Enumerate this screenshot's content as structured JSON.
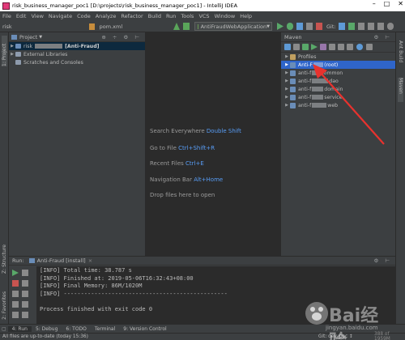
{
  "window": {
    "title": "risk_business_manager_poc1 [D:\\projects\\risk_business_manager_poc1] - IntelliJ IDEA",
    "controls": [
      "–",
      "□",
      "✕"
    ]
  },
  "menu": [
    "File",
    "Edit",
    "View",
    "Navigate",
    "Code",
    "Analyze",
    "Refactor",
    "Build",
    "Run",
    "Tools",
    "VCS",
    "Window",
    "Help"
  ],
  "toolbar": {
    "breadcrumb": "risk",
    "open_file": "pom.xml",
    "run_config": "AntiFraudWebApplication",
    "git_label": "Git:"
  },
  "project_panel": {
    "title": "Project",
    "rows": [
      {
        "label": "risk",
        "suffix": "[Anti-Fraud]",
        "selected": true
      },
      {
        "label": "External Libraries",
        "selected": false
      },
      {
        "label": "Scratches and Consoles",
        "selected": false
      }
    ]
  },
  "editor_hints": [
    {
      "text": "Search Everywhere",
      "key": "Double Shift"
    },
    {
      "text": "Go to File",
      "key": "Ctrl+Shift+R"
    },
    {
      "text": "Recent Files",
      "key": "Ctrl+E"
    },
    {
      "text": "Navigation Bar",
      "key": "Alt+Home"
    },
    {
      "text": "Drop files here to open",
      "key": ""
    }
  ],
  "maven_panel": {
    "title": "Maven",
    "rows": [
      {
        "label": "Profiles",
        "tail": "",
        "selected": false
      },
      {
        "label": "Anti-F",
        "tail": "(root)",
        "selected": true
      },
      {
        "label": "anti-f",
        "tail": "common",
        "selected": false
      },
      {
        "label": "anti-f",
        "tail": "dao",
        "selected": false
      },
      {
        "label": "anti-f",
        "tail": "domain",
        "selected": false
      },
      {
        "label": "anti-f",
        "tail": "service",
        "selected": false
      },
      {
        "label": "anti-f",
        "tail": "web",
        "selected": false
      }
    ]
  },
  "left_stripe": {
    "project_tab": "1: Project",
    "structure_tab": "Z: Structure",
    "favorites_tab": "2: Favorites"
  },
  "right_stripe": {
    "ant_tab": "Ant Build",
    "maven_tab": "Maven"
  },
  "run_panel": {
    "label": "Run:",
    "tab": "Anti-Fraud [install]",
    "console_lines": [
      "[INFO] Total time: 38.787 s",
      "[INFO] Finished at: 2019-05-06T16:32:43+08:00",
      "[INFO] Final Memory: 86M/1020M",
      "[INFO] ------------------------------------------------",
      "",
      "Process finished with exit code 0"
    ]
  },
  "bottom_tools": [
    "4: Run",
    "5: Debug",
    "6: TODO",
    "Terminal",
    "9: Version Control"
  ],
  "status": {
    "message": "All files are up-to-date (today 15:36)",
    "git": "Git: dev_poc ↕",
    "memory": "388 of 1959M"
  },
  "watermark": {
    "brand": "Bai经验",
    "url": "jingyan.baidu.com"
  },
  "colors": {
    "selection": "#2f65ca",
    "key_hint": "#589df6",
    "annotation": "#e8322e"
  }
}
